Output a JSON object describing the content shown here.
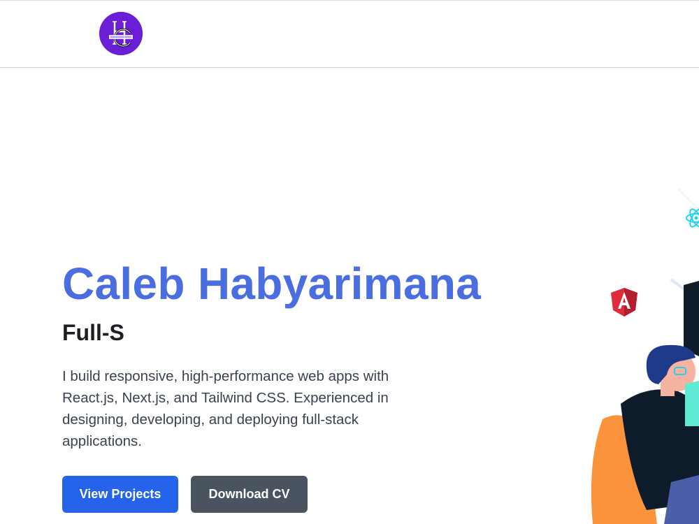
{
  "header": {
    "logo": {
      "icon": "hc-monogram-logo",
      "bg_color": "#6a1fd6"
    }
  },
  "hero": {
    "name": "Caleb Habyarimana",
    "role": "Full-S",
    "description": "I build responsive, high-performance web apps with React.js, Next.js, and Tailwind CSS. Experienced in designing, developing, and deploying full-stack applications.",
    "buttons": {
      "primary_label": "View Projects",
      "secondary_label": "Download CV"
    }
  },
  "illustration": {
    "icons": [
      "react-icon",
      "angular-icon",
      "developer-figure"
    ]
  },
  "colors": {
    "accent": "#4a6ee0",
    "primary_button": "#2563eb",
    "secondary_button": "#4a5360"
  }
}
